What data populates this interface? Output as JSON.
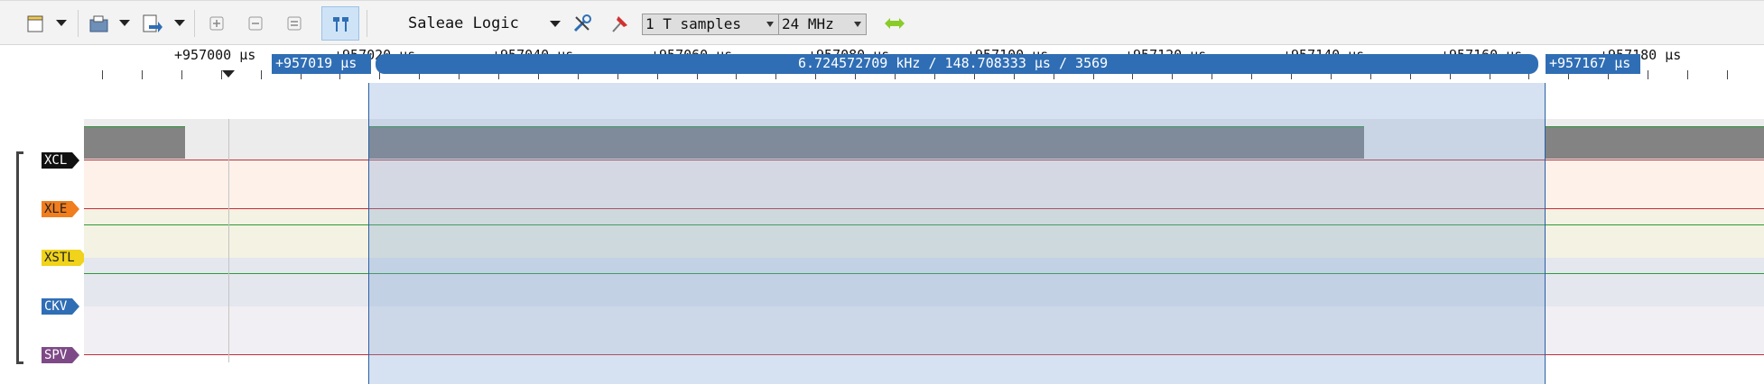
{
  "toolbar": {
    "device_name": "Saleae Logic",
    "samples_value": "1 T samples",
    "rate_value": "24 MHz"
  },
  "ruler": {
    "labels": [
      "+957000 µs",
      "+957020 µs",
      "+957040 µs",
      "+957060 µs",
      "+957080 µs",
      "+957100 µs",
      "+957120 µs",
      "+957140 µs",
      "+957160 µs",
      "+957180 µs"
    ],
    "left_marker": "+957019 µs",
    "right_marker": "+957167 µs",
    "measurement": "6.724572709 kHz / 148.708333 µs / 3569"
  },
  "channels": [
    {
      "label": "XCL",
      "color": "#111111",
      "text_color": "#ffffff"
    },
    {
      "label": "XLE",
      "color": "#f07d1e",
      "text_color": "#222222"
    },
    {
      "label": "XSTL",
      "color": "#f0d31a",
      "text_color": "#222222"
    },
    {
      "label": "CKV",
      "color": "#2f6eb5",
      "text_color": "#ffffff"
    },
    {
      "label": "SPV",
      "color": "#7d4a87",
      "text_color": "#ffffff"
    }
  ],
  "icons": [
    "new-session-icon",
    "open-icon",
    "export-icon",
    "zoom-in-icon",
    "zoom-out-icon",
    "zoom-fit-icon",
    "markers-icon",
    "settings-icon",
    "trigger-icon",
    "start-icon"
  ]
}
